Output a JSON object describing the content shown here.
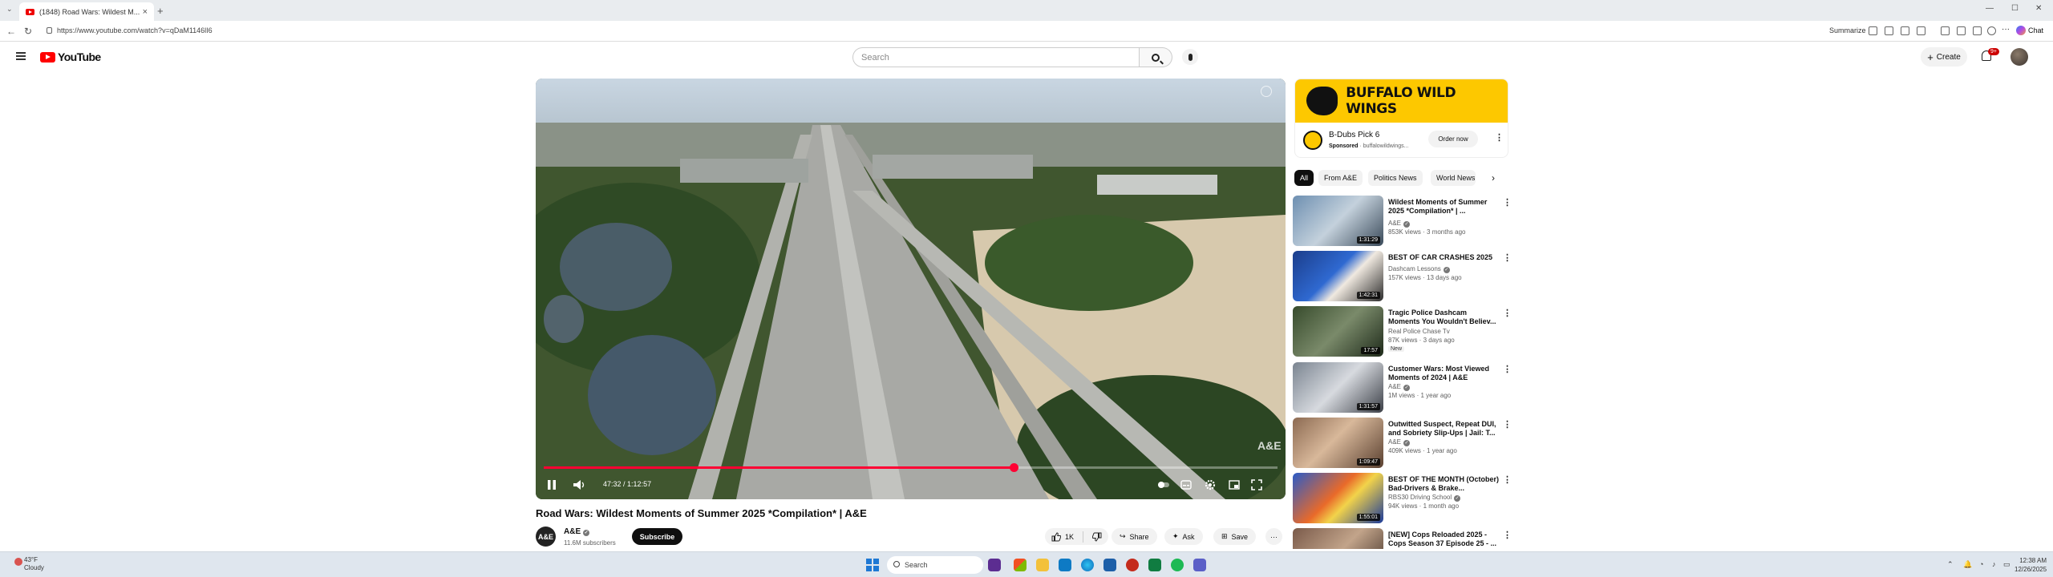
{
  "browser": {
    "tab_title": "(1848) Road Wars: Wildest M...",
    "tab_close": "×",
    "new_tab": "+",
    "url": "https://www.youtube.com/watch?v=qDaM1146lI6",
    "summarize_label": "Summarize",
    "copilot_label": "Chat"
  },
  "youtube": {
    "logo_text": "YouTube",
    "search_placeholder": "Search",
    "create_label": "Create",
    "notification_count": "9+"
  },
  "player": {
    "time_current": "47:32",
    "time_total": "1:12:57",
    "time_separator": " / ",
    "progress_fraction": 0.64,
    "watermark": "A&E"
  },
  "video": {
    "title": "Road Wars: Wildest Moments of Summer 2025 *Compilation* | A&E",
    "channel_name": "A&E",
    "channel_avatar_text": "A&E",
    "subscribers": "11.6M subscribers",
    "subscribe_label": "Subscribe",
    "like_count": "1K",
    "share_label": "Share",
    "ask_label": "Ask",
    "save_label": "Save"
  },
  "ad": {
    "banner_text": "BUFFALO WILD WINGS",
    "title": "B-Dubs Pick 6",
    "sponsored_label": "Sponsored",
    "domain": "· buffalowildwings...",
    "cta": "Order now"
  },
  "chips": [
    "All",
    "From A&E",
    "Politics News",
    "World News"
  ],
  "recommendations": [
    {
      "title": "Wildest Moments of Summer 2025 *Compilation* | ...",
      "channel": "A&E",
      "meta": "853K views · 3 months ago",
      "duration": "1:31:29",
      "badge": ""
    },
    {
      "title": "BEST OF CAR CRASHES 2025",
      "channel": "Dashcam Lessons",
      "meta": "157K views · 13 days ago",
      "duration": "1:42:31",
      "badge": ""
    },
    {
      "title": "Tragic Police Dashcam Moments You Wouldn't Believ...",
      "channel": "Real Police Chase Tv",
      "meta": "87K views · 3 days ago",
      "duration": "17:57",
      "badge": "New"
    },
    {
      "title": "Customer Wars: Most Viewed Moments of 2024 | A&E",
      "channel": "A&E",
      "meta": "1M views · 1 year ago",
      "duration": "1:31:57",
      "badge": ""
    },
    {
      "title": "Outwitted Suspect, Repeat DUI, and Sobriety Slip-Ups | Jail: T...",
      "channel": "A&E",
      "meta": "409K views · 1 year ago",
      "duration": "1:09:47",
      "badge": ""
    },
    {
      "title": "BEST OF THE MONTH (October) Bad-Drivers & Brake...",
      "channel": "RBS30 Driving School",
      "meta": "94K views · 1 month ago",
      "duration": "1:55:01",
      "badge": ""
    },
    {
      "title": "[NEW] Cops Reloaded 2025 - Cops Season 37 Episode 25 - ...",
      "channel": "",
      "meta": "",
      "duration": "",
      "badge": ""
    }
  ],
  "taskbar": {
    "temp": "43°F",
    "condition": "Cloudy",
    "search_label": "Search",
    "time": "12:38 AM",
    "date": "12/26/2025"
  }
}
